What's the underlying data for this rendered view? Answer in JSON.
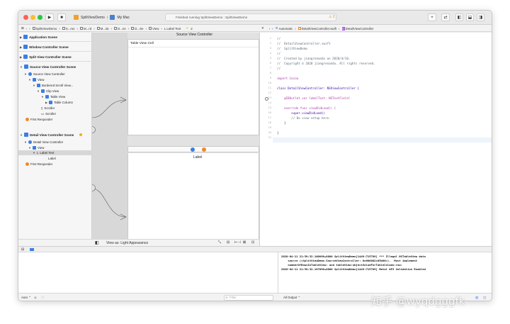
{
  "toolbar": {
    "project": "SplitViewDemo",
    "destination": "My Mac",
    "status": "Finished running SplitViewDemo : SplitViewDemo",
    "warning_count": "2",
    "add_label": "+"
  },
  "jumpbar_left": {
    "items": [
      "SplitViewDemo",
      "S...mo",
      "M...rd",
      "M...ds",
      "D...ne",
      "D...Se",
      "View",
      "Label Text"
    ],
    "warning_count": "2"
  },
  "jumpbar_right": {
    "items": [
      "Automatic",
      "DetailViewController.swift",
      "DetailViewController"
    ]
  },
  "outline": {
    "scenes": [
      {
        "label": "Application Scene"
      },
      {
        "label": "Window Controller Scene"
      },
      {
        "label": "Split View Controller Scene"
      },
      {
        "label": "Source View Controller Scene"
      },
      {
        "label": "Detail View Controller Scene"
      }
    ],
    "source_tree": [
      "Source View Controller",
      "View",
      "Bordered Scroll View...",
      "Clip View",
      "Table View",
      "Table Column",
      "Scroller",
      "Scroller",
      "First Responder"
    ],
    "detail_tree": [
      "Detail View Controller",
      "View",
      "Label Text",
      "Label",
      "First Responder"
    ],
    "filter_placeholder": "Filter"
  },
  "canvas": {
    "source_title": "Source View Controller",
    "table_cell": "Table View Cell",
    "detail_label": "Label",
    "view_as": "View as: Light Appearance"
  },
  "editor": {
    "line_numbers": [
      "1",
      "2",
      "3",
      "4",
      "5",
      "6",
      "7",
      "8",
      "9",
      "10",
      "11",
      "12",
      "13",
      "14",
      "15",
      "16",
      "17",
      "18",
      "19",
      "20",
      "21"
    ],
    "lines": [
      "//",
      "//  DetailViewController.swift",
      "//  SplitViewDemo",
      "//",
      "//  Created by jiangrenandu on 2020/4/10.",
      "//  Copyright © 2020 jiangrenandu. All rights reserved.",
      "//",
      "",
      "import Cocoa",
      "",
      "class DetailViewController: NSViewController {",
      "",
      "    @IBOutlet var labelText: NSTextField!",
      "",
      "    override func viewDidLoad() {",
      "        super.viewDidLoad()",
      "        // Do view setup here.",
      "    }",
      "",
      "}",
      ""
    ]
  },
  "console": {
    "lines": [
      "2020-04-11 21:58:32.160898+0800 SplitViewDemo[1449:715789] *** Illegal NSTableView data",
      "    source (<SplitViewDemo.SourceViewController: 0x600002c05b00>).  Must implement",
      "    numberOfRowsInTableView: and tableView:objectValueForTableColumn:row:",
      "2020-04-11 21:58:32.187698+0800 SplitViewDemo[1449:715789] Metal API Validation Enabled"
    ]
  },
  "bottom": {
    "auto": "Auto",
    "filter_placeholder": "Filter",
    "all_output": "All Output"
  },
  "watermark": "知乎 @wyqdgggfk",
  "colors": {
    "scene_blue": "#3a7ee5",
    "keyword": "#ad3da4",
    "comment": "#5d6c79",
    "type": "#3900a0"
  }
}
